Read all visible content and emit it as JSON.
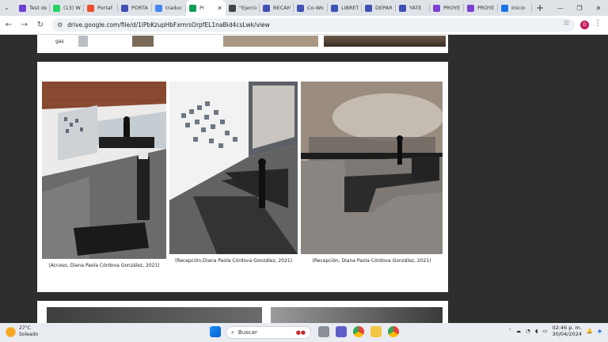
{
  "browser": {
    "tabs": [
      {
        "label": "Test de",
        "color": "#6b3fd1"
      },
      {
        "label": "(13) W",
        "color": "#25d366"
      },
      {
        "label": "Portaf",
        "color": "#ee4d2d"
      },
      {
        "label": "PORTA",
        "color": "#3f51b5"
      },
      {
        "label": "traduc",
        "color": "#4285f4"
      },
      {
        "label": "Pr",
        "color": "#0f9d58",
        "active": true
      },
      {
        "label": "\"Ejercic",
        "color": "#444444"
      },
      {
        "label": "RECAM",
        "color": "#3f51b5"
      },
      {
        "label": "Co-Wo",
        "color": "#3f51b5"
      },
      {
        "label": "LIBRET",
        "color": "#3f51b5"
      },
      {
        "label": "DEPAR",
        "color": "#3f51b5"
      },
      {
        "label": "YATE",
        "color": "#3f51b5"
      },
      {
        "label": "PROYE",
        "color": "#7b3fd1"
      },
      {
        "label": "PROYE",
        "color": "#7b3fd1"
      },
      {
        "label": "Inicio",
        "color": "#1a73e8"
      }
    ],
    "url": "drive.google.com/file/d/1lPbKzupHbFxmrsOrpfEL1naBid4csLwk/view",
    "profile_initial": "D"
  },
  "document": {
    "top_fragment_text": "gas",
    "photos": [
      {
        "caption": "(Acceso, Diana Paola Córdova González, 2021)"
      },
      {
        "caption": "(Recepción,Diana Paola Córdova González, 2021)"
      },
      {
        "caption": "(Recepción, Diana Paola Córdova González, 2021)"
      }
    ]
  },
  "taskbar": {
    "weather_temp": "27°C",
    "weather_desc": "Soleado",
    "search_placeholder": "Buscar",
    "time": "02:46 p. m.",
    "date": "30/04/2024"
  }
}
